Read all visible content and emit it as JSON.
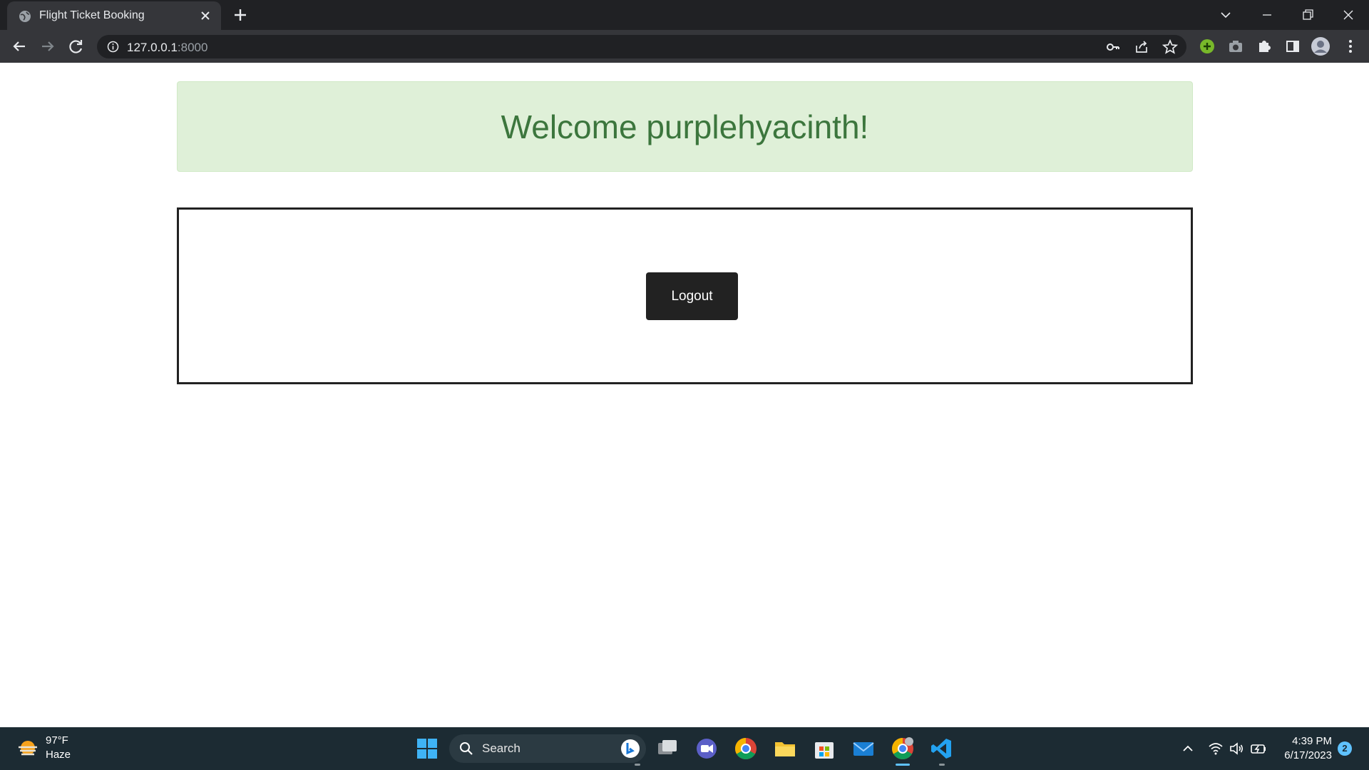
{
  "browser": {
    "tab_title": "Flight Ticket Booking",
    "url_host": "127.0.0.1",
    "url_port": ":8000"
  },
  "page": {
    "welcome_message": "Welcome purplehyacinth!",
    "logout_label": "Logout"
  },
  "taskbar": {
    "weather_temp": "97°F",
    "weather_desc": "Haze",
    "search_label": "Search",
    "time": "4:39 PM",
    "date": "6/17/2023",
    "notification_count": "2"
  },
  "colors": {
    "welcome_bg": "#dff0d8",
    "welcome_text": "#3c763d",
    "button_bg": "#222222"
  }
}
